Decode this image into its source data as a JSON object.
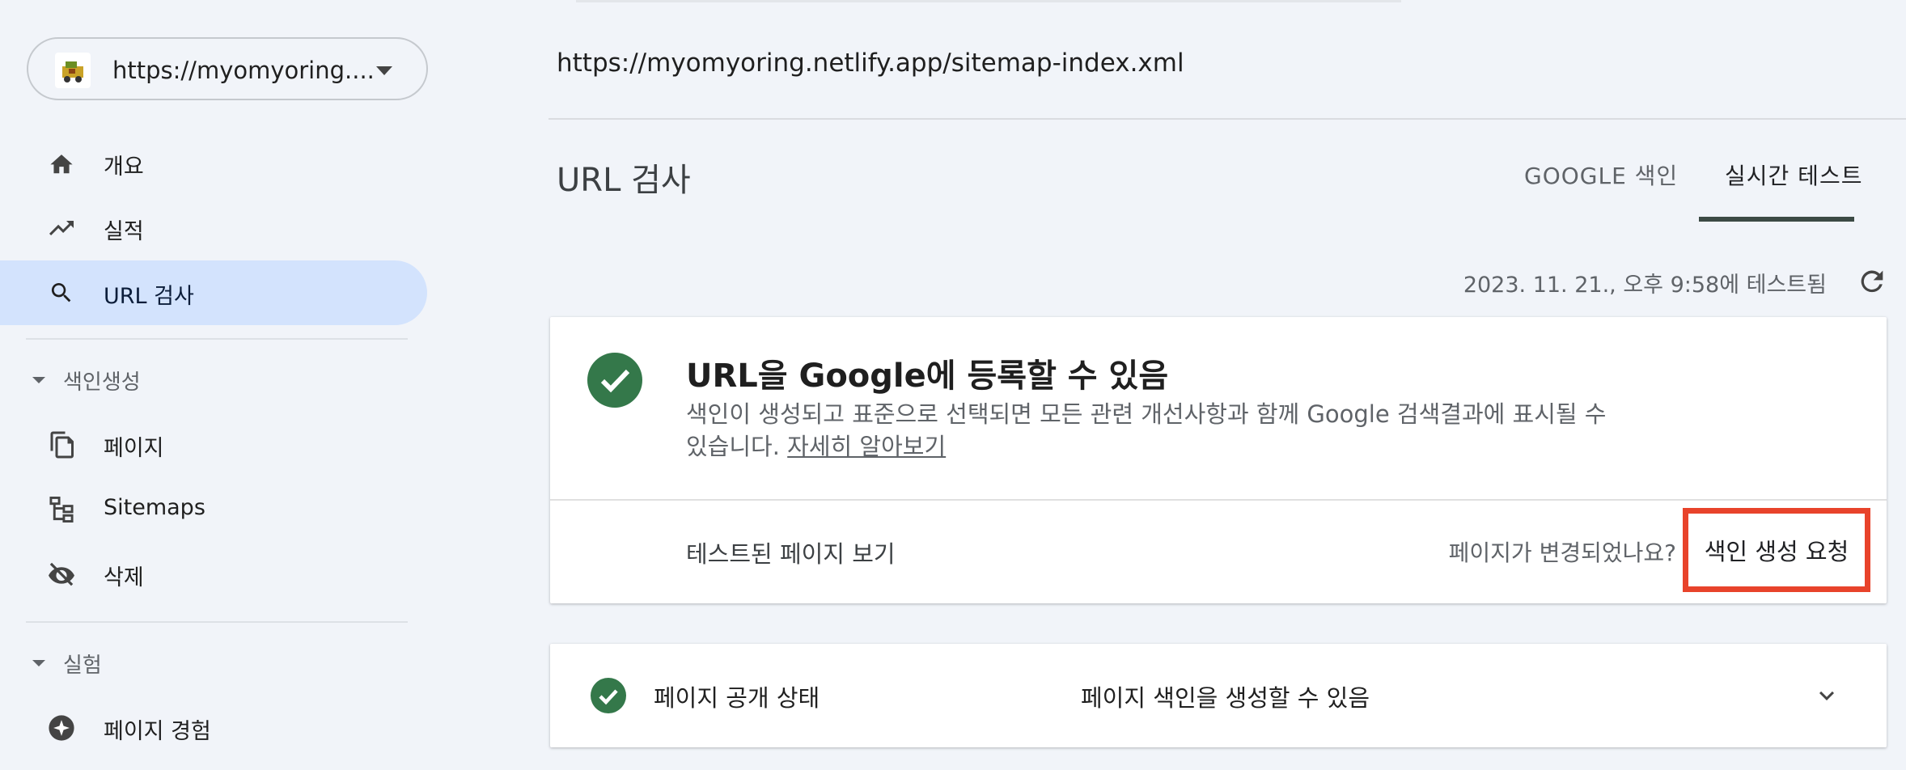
{
  "property": {
    "url": "https://myomyoring....",
    "icon": "property-favicon"
  },
  "sidebar": {
    "items": [
      {
        "label": "개요",
        "icon": "home-icon"
      },
      {
        "label": "실적",
        "icon": "trending-up-icon"
      },
      {
        "label": "URL 검사",
        "icon": "search-icon",
        "selected": true
      }
    ],
    "section_indexing": {
      "label": "색인생성",
      "items": [
        {
          "label": "페이지",
          "icon": "pages-icon"
        },
        {
          "label": "Sitemaps",
          "icon": "sitemap-icon"
        },
        {
          "label": "삭제",
          "icon": "eye-off-icon"
        }
      ]
    },
    "section_experience": {
      "label": "실험",
      "items": [
        {
          "label": "페이지 경험",
          "icon": "experience-icon"
        }
      ]
    }
  },
  "main": {
    "inspected_url": "https://myomyoring.netlify.app/sitemap-index.xml",
    "title": "URL 검사",
    "tabs": [
      {
        "label": "GOOGLE 색인",
        "active": false
      },
      {
        "label": "실시간 테스트",
        "active": true
      }
    ],
    "tested_at": "2023. 11. 21., 오후 9:58에 테스트됨",
    "result_card": {
      "title": "URL을 Google에 등록할 수 있음",
      "description": "색인이 생성되고 표준으로 선택되면 모든 관련 개선사항과 함께 Google 검색결과에 표시될 수 있습니다.",
      "learn_more": "자세히 알아보기",
      "view_tested_page": "테스트된 페이지 보기",
      "changed_question": "페이지가 변경되었나요?",
      "request_indexing": "색인 생성 요청",
      "status_color": "#34784a"
    },
    "availability_row": {
      "label": "페이지 공개 상태",
      "value": "페이지 색인을 생성할 수 있음"
    }
  },
  "colors": {
    "accent_selected": "#d3e3fd",
    "highlight_box": "#e8432b",
    "success": "#34784a"
  }
}
